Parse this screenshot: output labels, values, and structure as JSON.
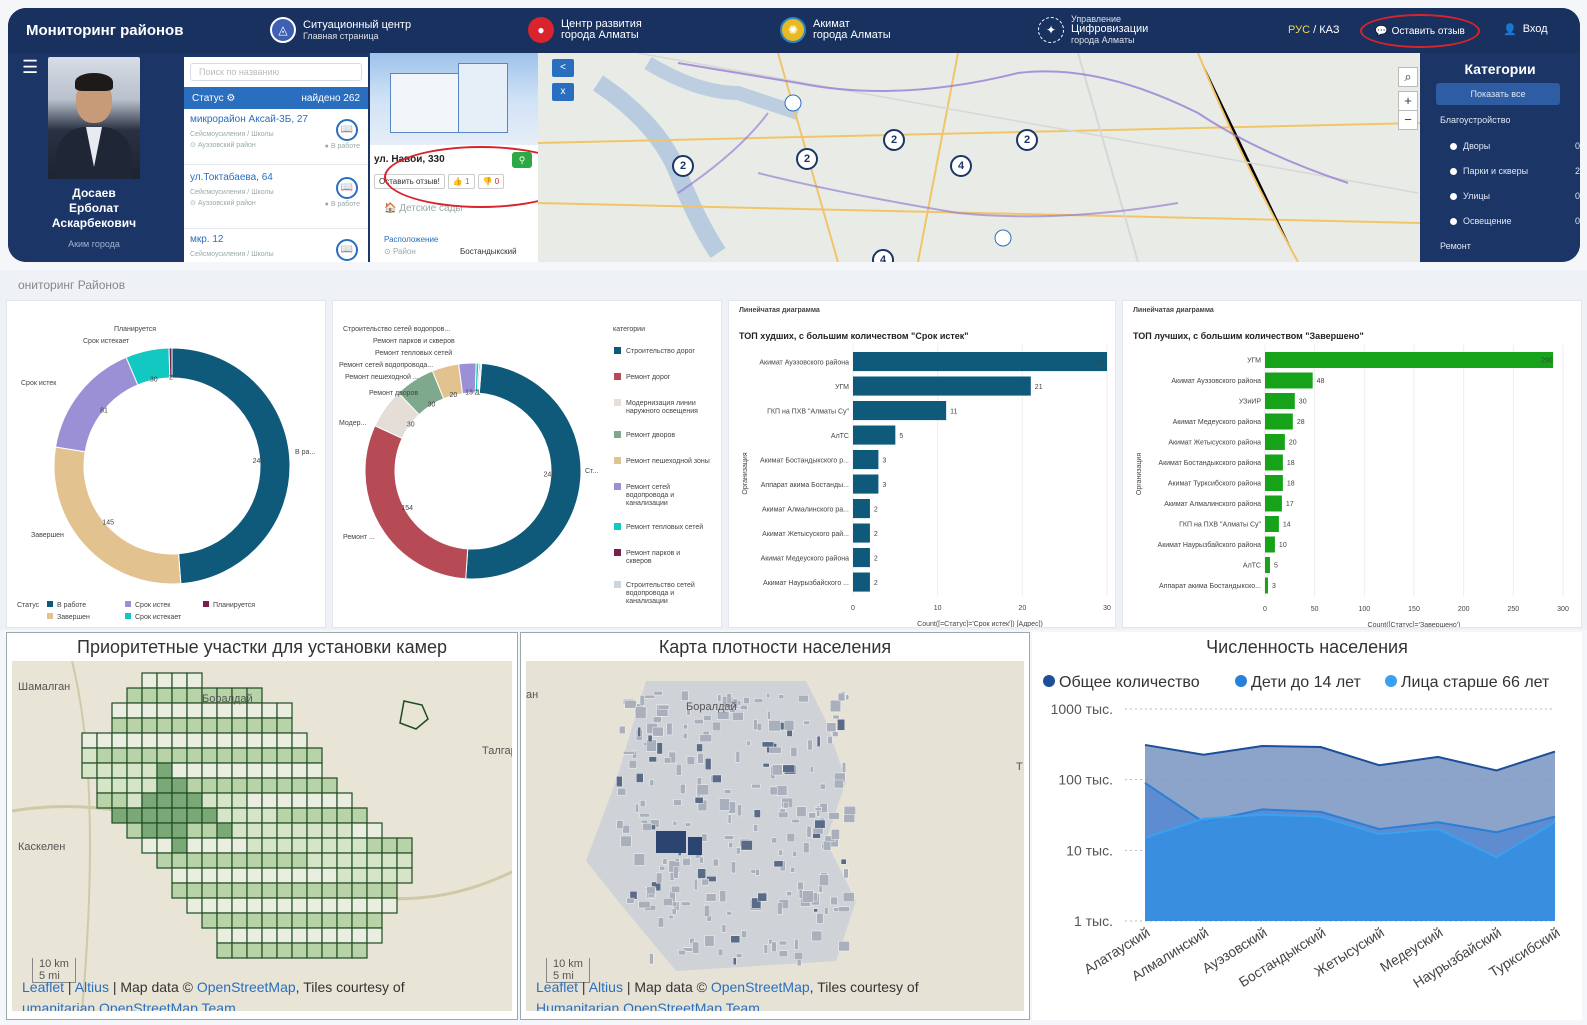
{
  "topbar": {
    "brand": "Мониторинг районов",
    "links": [
      {
        "t1": "Ситуационный центр",
        "t2": "Главная страница",
        "icon": "situation-icon"
      },
      {
        "t1": "Центр развития",
        "t2": "города Алматы",
        "icon": "apple-icon"
      },
      {
        "t1": "Акимат",
        "t2": "города Алматы",
        "icon": "emblem-icon"
      },
      {
        "t1": "Цифровизации",
        "t2": "города Алматы",
        "t0": "Управление",
        "icon": "digital-icon"
      }
    ],
    "lang_ru": "РУС",
    "lang_sep": "/",
    "lang_kz": "КАЗ",
    "feedback": "Оставить отзыв",
    "login": "Вход"
  },
  "profile": {
    "name_1": "Досаев",
    "name_2": "Ерболат",
    "name_3": "Аскарбекович",
    "role": "Аким города"
  },
  "list": {
    "search_placeholder": "Поиск по названию",
    "status_label": "Статус",
    "found": "найдено 262",
    "items": [
      {
        "title": "микрорайон Аксай-3Б, 27",
        "cat": "Сейсмоусиления / Школы",
        "district": "Ауэзовский район",
        "status": "В работе"
      },
      {
        "title": "ул.Токтабаева, 64",
        "cat": "Сейсмоусиления / Школы",
        "district": "Ауэзовский район",
        "status": "В работе"
      },
      {
        "title": "мкр. 12",
        "cat": "Сейсмоусиления / Школы",
        "district": "",
        "status": ""
      }
    ]
  },
  "popup": {
    "address": "ул. Навои, 330",
    "feedback": "Оставить отзыв!",
    "likes": "1",
    "dislikes": "0",
    "category": "Детские сады",
    "loc_label": "Расположение",
    "region_label": "Район",
    "region": "Бостандыкский"
  },
  "map1": {
    "clusters": [
      "2",
      "2",
      "2",
      "2",
      "4",
      "2",
      "4"
    ],
    "btn_back": "<",
    "btn_close": "x",
    "zoom_in": "+",
    "zoom_out": "−"
  },
  "categories": {
    "title": "Категории",
    "show_all": "Показать все",
    "section1": "Благоустройство",
    "items": [
      {
        "label": "Дворы",
        "count": "0"
      },
      {
        "label": "Парки и скверы",
        "count": "2"
      },
      {
        "label": "Улицы",
        "count": "0"
      },
      {
        "label": "Освещение",
        "count": "0"
      }
    ],
    "section2": "Ремонт"
  },
  "analytics": {
    "title": "ониторинг Районов",
    "donut1": {
      "labels": {
        "planned": "Планируется",
        "soon": "Срок истекает",
        "expired": "Срок истек",
        "done": "Завершен",
        "work": "В ра..."
      },
      "legend_title": "Статус",
      "legend": [
        "В работе",
        "Срок истек",
        "Планируется",
        "Завершен",
        "Срок истекает"
      ]
    },
    "donut2": {
      "callouts": [
        "Строительство сетей водопров...",
        "Ремонт парков и скверов",
        "Ремонт тепловых сетей",
        "Ремонт сетей водопровода...",
        "Ремонт пешеходной ...",
        "Ремонт дворов",
        "Модер...",
        "Ремонт ...",
        "Ст..."
      ],
      "legend_title": "категории",
      "legend": [
        "Строительство дорог",
        "Ремонт дорог",
        "Модернизация линии наружного освещения",
        "Ремонт дворов",
        "Ремонт пешеходной зоны",
        "Ремонт сетей водопровода и канализации",
        "Ремонт тепловых сетей",
        "Ремонт парков и скверов",
        "Строительство сетей водопровода и канализации"
      ]
    },
    "bar1": {
      "card_title": "Линейчатая диаграмма",
      "subtitle": "ТОП худших, с большим количеством \"Срок истек\"",
      "ylabel": "Организация",
      "xlabel": "Count([=Статус]='Срок истек']) [Адрес])"
    },
    "bar2": {
      "card_title": "Линейчатая диаграмма",
      "subtitle": "ТОП лучших, с большим количеством \"Завершено\"",
      "ylabel": "Организация",
      "xlabel": "Count([Статус]='Завершено')"
    }
  },
  "chart_data": [
    {
      "type": "pie",
      "variant": "donut",
      "title": "",
      "categories": [
        "В работе",
        "Завершен",
        "Срок истек",
        "Срок истекает",
        "Планируется"
      ],
      "values": [
        246,
        145,
        81,
        30,
        2
      ],
      "colors": [
        "#0f5a7a",
        "#e2c28f",
        "#9b8fd6",
        "#13c8c0",
        "#7a1f4a"
      ]
    },
    {
      "type": "pie",
      "variant": "donut",
      "title": "",
      "categories": [
        "Строительство дорог",
        "Ремонт дорог",
        "Модернизация линии наружного освещения",
        "Ремонт дворов",
        "Ремонт пешеходной зоны",
        "Ремонт сетей водопровода и канализации",
        "Ремонт тепловых сетей",
        "Ремонт парков и скверов",
        "Строительство сетей водопровода и канализации"
      ],
      "values": [
        249,
        154,
        30,
        30,
        20,
        13,
        2,
        1,
        1
      ],
      "colors": [
        "#0f5a7a",
        "#b64a55",
        "#e4ddd8",
        "#7ea98c",
        "#e2c28f",
        "#9b8fd6",
        "#13c8c0",
        "#7a1f4a",
        "#cbd5dc"
      ]
    },
    {
      "type": "bar",
      "orientation": "horizontal",
      "title": "ТОП худших, с большим количеством \"Срок истек\"",
      "categories": [
        "Акимат Ауэзовского района",
        "УГМ",
        "ГКП на ПХВ \"Алматы Су\"",
        "АлТС",
        "Акимат Бостандыкского р...",
        "Аппарат акима Бостанды...",
        "Акимат Алмалинского ра...",
        "Акимат Жетысуского рай...",
        "Акимат Медеуского района",
        "Акимат Наурызбайского ..."
      ],
      "values": [
        30,
        21,
        11,
        5,
        3,
        3,
        2,
        2,
        2,
        2
      ],
      "xlim": [
        0,
        30
      ],
      "xticks": [
        0,
        10,
        20,
        30
      ],
      "color": "#0f5a7a"
    },
    {
      "type": "bar",
      "orientation": "horizontal",
      "title": "ТОП лучших, с большим количеством \"Завершено\"",
      "categories": [
        "УГМ",
        "Акимат Ауэзовского района",
        "УЗиИР",
        "Акимат Медеуского района",
        "Акимат Жетысуского района",
        "Акимат Бостандыкского района",
        "Акимат Турксибского района",
        "Акимат Алмалинского района",
        "ГКП на ПХВ \"Алматы Су\"",
        "Акимат Наурызбайского района",
        "АлТС",
        "Аппарат акима Бостандыкско..."
      ],
      "values": [
        290,
        48,
        30,
        28,
        20,
        18,
        18,
        17,
        14,
        10,
        5,
        3
      ],
      "xlim": [
        0,
        300
      ],
      "xticks": [
        0,
        50,
        100,
        150,
        200,
        250,
        300
      ],
      "color": "#16a31a"
    },
    {
      "type": "area",
      "title": "Численность населения",
      "scale": "log",
      "categories": [
        "Алатауский",
        "Алмалинский",
        "Ауэзовский",
        "Бостандыкский",
        "Жетысуский",
        "Медеуский",
        "Наурызбайский",
        "Турксибский"
      ],
      "yticks": [
        "1 тыс.",
        "10 тыс.",
        "100 тыс.",
        "1000 тыс."
      ],
      "series": [
        {
          "name": "Общее количество",
          "values": [
            310000,
            225000,
            300000,
            290000,
            160000,
            210000,
            135000,
            250000
          ]
        },
        {
          "name": "Дети до 14 лет",
          "values": [
            90000,
            25000,
            38000,
            35000,
            20000,
            25000,
            18000,
            30000
          ]
        },
        {
          "name": "Лица старше 66 лет",
          "values": [
            15000,
            28000,
            32000,
            30000,
            17000,
            20000,
            8000,
            25000
          ]
        }
      ]
    }
  ],
  "bottom": {
    "cameras": {
      "title": "Приоритетные участки для установки камер",
      "places": [
        "Шамалган",
        "Боралдай",
        "Талгар",
        "Каскелен"
      ],
      "scale": "10 km",
      "scale2": "5 mi"
    },
    "density": {
      "title": "Карта плотности населения",
      "places": [
        "Боралдай",
        "Тал",
        "Т",
        "зн"
      ],
      "scale": "10 km",
      "scale2": "5 mi"
    },
    "population": {
      "title": "Численность населения",
      "legend": [
        "Общее количество",
        "Дети до 14 лет",
        "Лица старше 66 лет"
      ]
    },
    "attr": {
      "leaflet": "Leaflet",
      "sep1": " | ",
      "altius": "Altius",
      "mid": " | Map data © ",
      "osm": "OpenStreetMap",
      "tail": ", Tiles courtesy of",
      "hot": "Humanitarian OpenStreetMap Team",
      "hot2": "umanitarian OpenStreetMap Team"
    }
  }
}
